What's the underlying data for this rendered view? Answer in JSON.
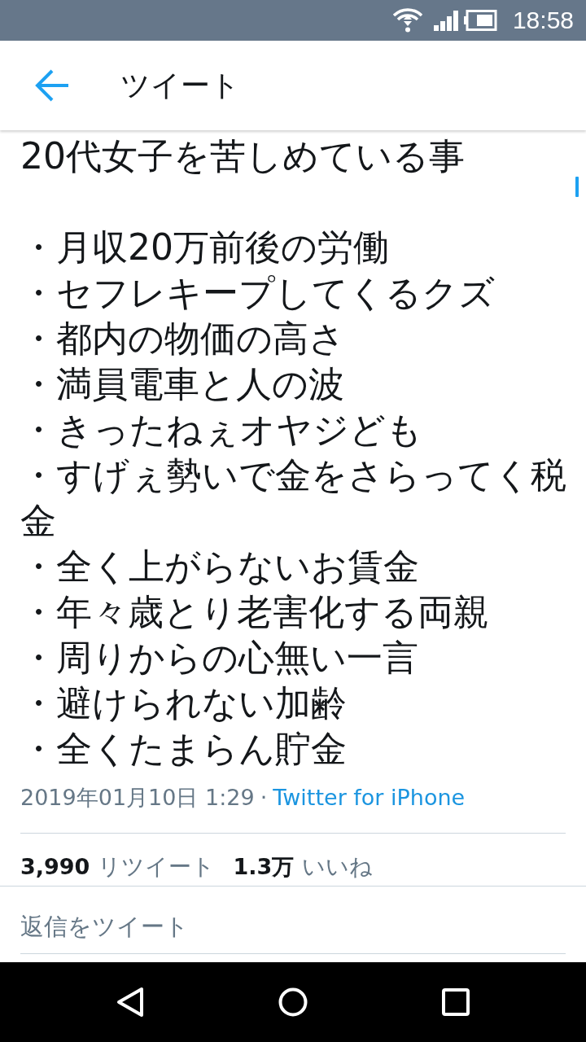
{
  "status_bar": {
    "time": "18:58"
  },
  "header": {
    "title": "ツイート"
  },
  "tweet": {
    "heading": "20代女子を苦しめている事",
    "items": [
      "・月収20万前後の労働",
      "・セフレキープしてくるクズ",
      "・都内の物価の高さ",
      "・満員電車と人の波",
      "・きったねぇオヤジども",
      "・すげぇ勢いで金をさらってく税金",
      "・全く上がらないお賃金",
      "・年々歳とり老害化する両親",
      "・周りからの心無い一言",
      "・避けられない加齢",
      "・全くたまらん貯金"
    ],
    "timestamp": "2019年01月10日 1:29",
    "separator": "·",
    "source": "Twitter for iPhone"
  },
  "stats": [
    {
      "count": "3,990",
      "label": "リツイート"
    },
    {
      "count": "1.3万",
      "label": "いいね"
    }
  ],
  "reply": {
    "placeholder": "返信をツイート"
  }
}
